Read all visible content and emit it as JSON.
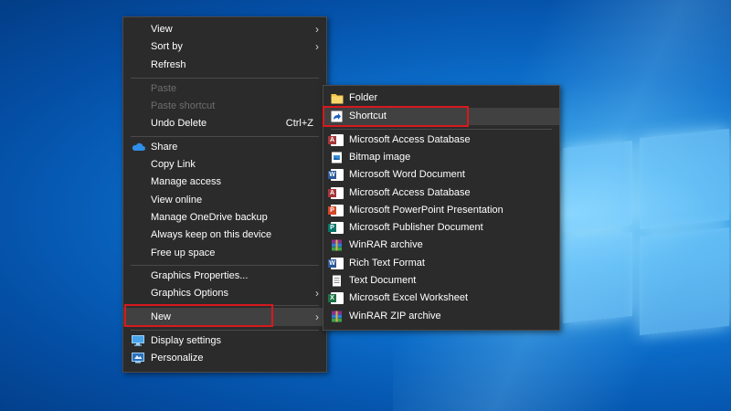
{
  "context_menu": {
    "items": [
      {
        "label": "View",
        "submenu": true
      },
      {
        "label": "Sort by",
        "submenu": true
      },
      {
        "label": "Refresh"
      },
      {
        "label": "Paste",
        "disabled": true
      },
      {
        "label": "Paste shortcut",
        "disabled": true
      },
      {
        "label": "Undo Delete",
        "shortcut": "Ctrl+Z"
      },
      {
        "label": "Share",
        "icon": "onedrive-icon"
      },
      {
        "label": "Copy Link"
      },
      {
        "label": "Manage access"
      },
      {
        "label": "View online"
      },
      {
        "label": "Manage OneDrive backup"
      },
      {
        "label": "Always keep on this device"
      },
      {
        "label": "Free up space"
      },
      {
        "label": "Graphics Properties..."
      },
      {
        "label": "Graphics Options",
        "submenu": true
      },
      {
        "label": "New",
        "submenu": true,
        "highlighted": true
      },
      {
        "label": "Display settings",
        "icon": "display-icon"
      },
      {
        "label": "Personalize",
        "icon": "personalize-icon"
      }
    ]
  },
  "new_submenu": {
    "items": [
      {
        "label": "Folder",
        "icon": "folder-icon"
      },
      {
        "label": "Shortcut",
        "icon": "shortcut-icon",
        "highlighted": true
      },
      {
        "label": "Microsoft Access Database",
        "icon": "access-icon"
      },
      {
        "label": "Bitmap image",
        "icon": "bitmap-icon"
      },
      {
        "label": "Microsoft Word Document",
        "icon": "word-icon"
      },
      {
        "label": "Microsoft Access Database",
        "icon": "access-icon"
      },
      {
        "label": "Microsoft PowerPoint Presentation",
        "icon": "powerpoint-icon"
      },
      {
        "label": "Microsoft Publisher Document",
        "icon": "publisher-icon"
      },
      {
        "label": "WinRAR archive",
        "icon": "winrar-icon"
      },
      {
        "label": "Rich Text Format",
        "icon": "rtf-icon"
      },
      {
        "label": "Text Document",
        "icon": "text-document-icon"
      },
      {
        "label": "Microsoft Excel Worksheet",
        "icon": "excel-icon"
      },
      {
        "label": "WinRAR ZIP archive",
        "icon": "winrar-zip-icon"
      }
    ]
  },
  "colors": {
    "menu_bg": "#2b2b2b",
    "highlight_border": "#d7191f",
    "desktop_blue": "#0b6cc8"
  }
}
